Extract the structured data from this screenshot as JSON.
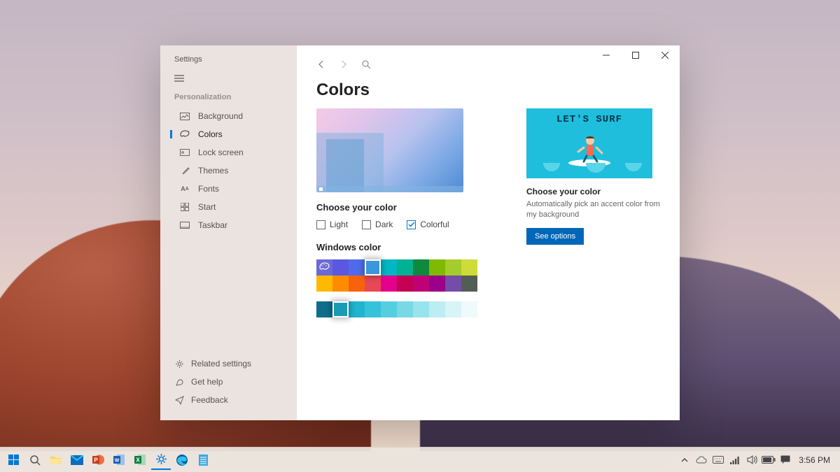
{
  "window": {
    "title": "Settings",
    "section": "Personalization"
  },
  "sidebar": {
    "items": [
      {
        "label": "Background",
        "icon": "image-icon"
      },
      {
        "label": "Colors",
        "icon": "palette-icon",
        "active": true
      },
      {
        "label": "Lock screen",
        "icon": "lock-screen-icon"
      },
      {
        "label": "Themes",
        "icon": "brush-icon"
      },
      {
        "label": "Fonts",
        "icon": "font-icon"
      },
      {
        "label": "Start",
        "icon": "start-icon"
      },
      {
        "label": "Taskbar",
        "icon": "taskbar-icon"
      }
    ],
    "footer": [
      {
        "label": "Related settings",
        "icon": "gear-icon"
      },
      {
        "label": "Get help",
        "icon": "help-icon"
      },
      {
        "label": "Feedback",
        "icon": "feedback-icon"
      }
    ]
  },
  "page": {
    "title": "Colors",
    "choose_label": "Choose your color",
    "options": {
      "light": "Light",
      "dark": "Dark",
      "colorful": "Colorful"
    },
    "selected_option": "colorful",
    "windows_color_label": "Windows color"
  },
  "palette": {
    "row1": [
      "#6b69d6",
      "#5a58e0",
      "#4f6bed",
      "#3a96dd",
      "#00b7c3",
      "#00b294",
      "#10893e",
      "#7fba00",
      "#a4cc2b",
      "#cddc39"
    ],
    "row2": [
      "#ffb900",
      "#ff8c00",
      "#f7630c",
      "#e74856",
      "#e3008c",
      "#c30052",
      "#bf0077",
      "#9a0089",
      "#744da9",
      "#525e54"
    ],
    "selected_index": 3
  },
  "shades": [
    "#0f6e8c",
    "#1b9ab6",
    "#1fb4cf",
    "#36c2d8",
    "#55cee0",
    "#78d9e6",
    "#99e3ed",
    "#bbedf3",
    "#d7f4f7",
    "#eefafc"
  ],
  "selected_shade_index": 1,
  "promo": {
    "headline": "LET'S SURF",
    "title": "Choose your color",
    "desc": "Automatically pick an accent color from my background",
    "button": "See options"
  },
  "taskbar": {
    "apps": [
      "start",
      "search",
      "explorer",
      "mail",
      "powerpoint",
      "word",
      "excel",
      "settings",
      "edge",
      "notepad"
    ],
    "active": "settings",
    "tray": [
      "chevron-up",
      "onedrive",
      "keyboard",
      "signal",
      "volume",
      "battery",
      "action-center"
    ],
    "clock": "3:56 PM"
  }
}
